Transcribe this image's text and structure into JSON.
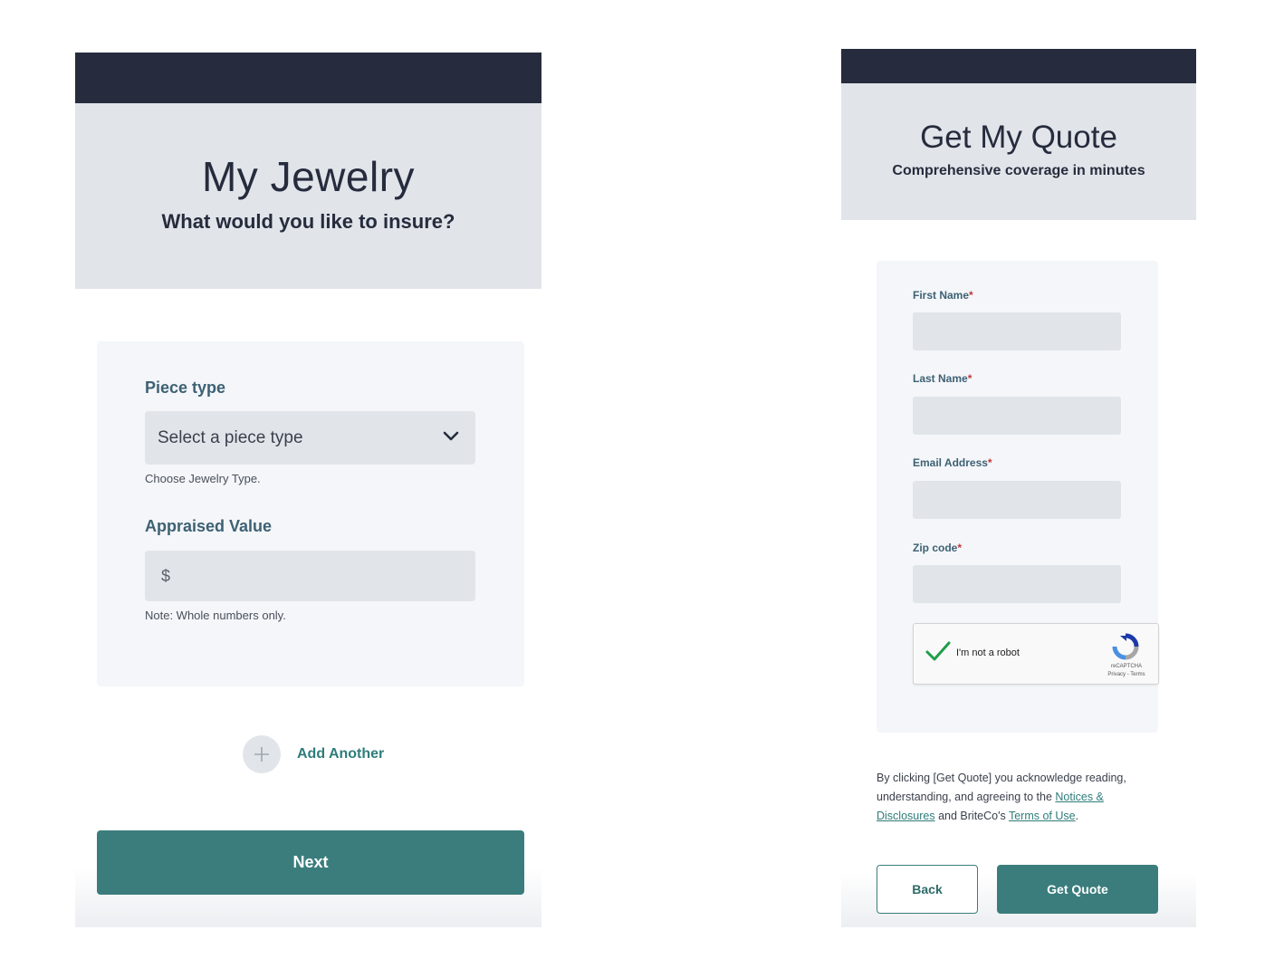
{
  "jewelry_screen": {
    "title": "My Jewelry",
    "subtitle": "What would you like to insure?",
    "piece_type": {
      "label": "Piece type",
      "selected": "Select a piece type",
      "helper": "Choose Jewelry Type."
    },
    "appraised_value": {
      "label": "Appraised Value",
      "prefix": "$",
      "note": "Note: Whole numbers only."
    },
    "add_another_label": "Add Another",
    "next_label": "Next"
  },
  "quote_screen": {
    "title": "Get My Quote",
    "subtitle": "Comprehensive coverage in minutes",
    "fields": {
      "first_name": {
        "label": "First Name",
        "required_mark": "*",
        "value": ""
      },
      "last_name": {
        "label": "Last Name",
        "required_mark": "*",
        "value": ""
      },
      "email": {
        "label": "Email Address",
        "required_mark": "*",
        "value": ""
      },
      "zip": {
        "label": "Zip code",
        "required_mark": "*",
        "value": ""
      }
    },
    "recaptcha": {
      "label": "I'm not a robot",
      "checked": true,
      "brand": "reCAPTCHA",
      "links": "Privacy - Terms"
    },
    "disclaimer": {
      "text_1": "By clicking [Get Quote] you acknowledge reading, understanding, and agreeing to the ",
      "link_1": "Notices & Disclosures",
      "text_2": " and BriteCo's ",
      "link_2": "Terms of Use",
      "text_3": "."
    },
    "back_label": "Back",
    "get_quote_label": "Get Quote"
  },
  "colors": {
    "header_bar": "#262c3d",
    "hero_bg": "#e1e5ea",
    "card_bg": "#f4f6f9",
    "accent": "#3a7d7c",
    "label_text": "#3d6173",
    "required": "#c0393b"
  },
  "icons": {
    "select_chevron": "chevron-down-icon",
    "add": "plus-icon",
    "recaptcha_check": "checkmark-icon",
    "recaptcha_logo": "recaptcha-logo-icon"
  }
}
